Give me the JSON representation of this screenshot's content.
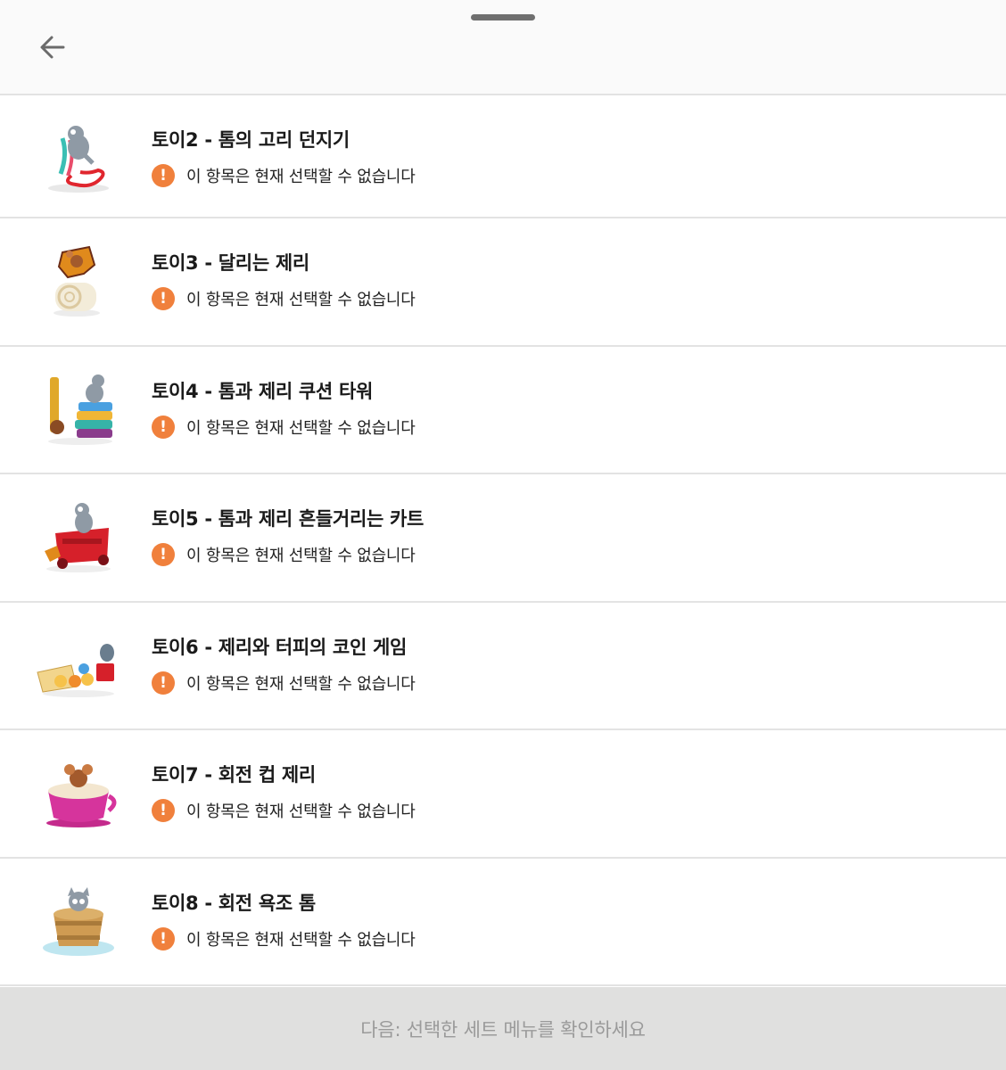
{
  "header": {
    "back_icon": "arrow-left-icon",
    "handle": "drag-handle"
  },
  "items": [
    {
      "title": "토이2 - 톰의 고리 던지기",
      "notice": "이 항목은 현재 선택할 수 없습니다",
      "notice_icon": "exclamation-circle-icon",
      "thumb": "toy-tom-ring-toss"
    },
    {
      "title": "토이3 - 달리는 제리",
      "notice": "이 항목은 현재 선택할 수 없습니다",
      "notice_icon": "exclamation-circle-icon",
      "thumb": "toy-running-jerry"
    },
    {
      "title": "토이4 - 톰과 제리 쿠션 타워",
      "notice": "이 항목은 현재 선택할 수 없습니다",
      "notice_icon": "exclamation-circle-icon",
      "thumb": "toy-cushion-tower"
    },
    {
      "title": "토이5 - 톰과 제리 흔들거리는 카트",
      "notice": "이 항목은 현재 선택할 수 없습니다",
      "notice_icon": "exclamation-circle-icon",
      "thumb": "toy-wobbly-cart"
    },
    {
      "title": "토이6 - 제리와 터피의 코인 게임",
      "notice": "이 항목은 현재 선택할 수 없습니다",
      "notice_icon": "exclamation-circle-icon",
      "thumb": "toy-coin-game"
    },
    {
      "title": "토이7 - 회전 컵 제리",
      "notice": "이 항목은 현재 선택할 수 없습니다",
      "notice_icon": "exclamation-circle-icon",
      "thumb": "toy-spinning-cup"
    },
    {
      "title": "토이8 - 회전 욕조 톰",
      "notice": "이 항목은 현재 선택할 수 없습니다",
      "notice_icon": "exclamation-circle-icon",
      "thumb": "toy-spinning-tub"
    }
  ],
  "footer": {
    "label": "다음: 선택한 세트 메뉴를 확인하세요"
  },
  "colors": {
    "warning": "#f0803c",
    "footer_bg": "#e0e0df",
    "footer_text": "#9a9a9a"
  }
}
